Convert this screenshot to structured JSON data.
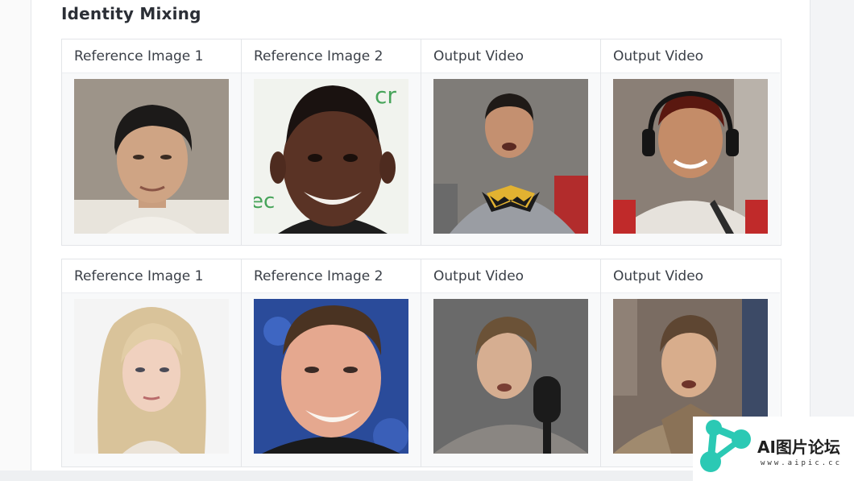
{
  "section": {
    "title": "Identity Mixing"
  },
  "rows": [
    {
      "cells": [
        {
          "header": "Reference Image 1",
          "image": "portrait-man-dark-hair-white-collar"
        },
        {
          "header": "Reference Image 2",
          "image": "portrait-man-smiling-short-hair"
        },
        {
          "header": "Output Video",
          "image": "video-frame-man-batman-shirt"
        },
        {
          "header": "Output Video",
          "image": "video-frame-man-headphones-jacket"
        }
      ]
    },
    {
      "cells": [
        {
          "header": "Reference Image 1",
          "image": "portrait-woman-blonde-hair"
        },
        {
          "header": "Reference Image 2",
          "image": "portrait-man-smiling-blue-background"
        },
        {
          "header": "Output Video",
          "image": "video-frame-man-microphone"
        },
        {
          "header": "Output Video",
          "image": "video-frame-man-robe-room"
        }
      ]
    }
  ],
  "watermark": {
    "title": "AI图片论坛",
    "url": "www.aipic.cc",
    "accent_color": "#2bc9b4"
  }
}
